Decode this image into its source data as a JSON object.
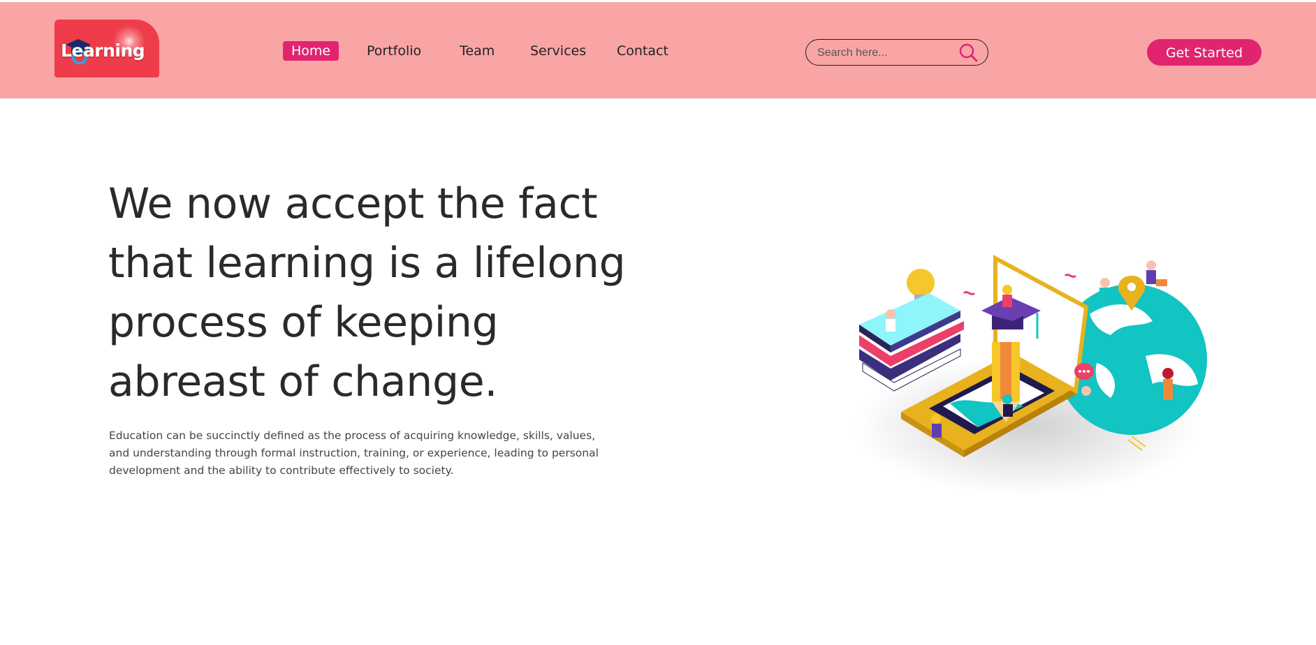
{
  "header": {
    "logo_text": "Learning",
    "nav": [
      {
        "label": "Home",
        "active": true
      },
      {
        "label": "Portfolio",
        "active": false
      },
      {
        "label": "Team",
        "active": false
      },
      {
        "label": "Services",
        "active": false
      },
      {
        "label": "Contact",
        "active": false
      }
    ],
    "search": {
      "placeholder": "Search here...",
      "value": "",
      "icon": "search-icon"
    },
    "cta_label": "Get Started"
  },
  "hero": {
    "title": "We now accept the fact that learning is a lifelong process of keeping abreast of change.",
    "description": "Education can be succinctly defined as the process of acquiring knowledge, skills, values, and understanding through formal instruction, training, or experience, leading to personal development and the ability to contribute effectively to society."
  },
  "colors": {
    "header_bg": "#f9a5a6",
    "accent": "#e0246f",
    "logo_bg": "#ee3c4a",
    "text_dark": "#2a2a2a"
  }
}
